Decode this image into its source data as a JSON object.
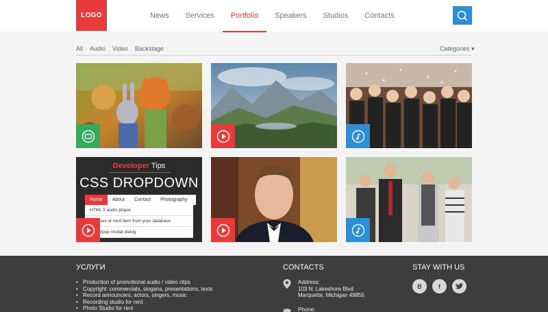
{
  "header": {
    "logo": "LOGO",
    "nav": [
      "News",
      "Services",
      "Portfolio",
      "Speakers",
      "Studios",
      "Contacts"
    ],
    "active_nav": "Portfolio"
  },
  "filters": {
    "items": [
      "All",
      "Audio",
      "Video",
      "Backstage"
    ],
    "categories_label": "Categories ▾"
  },
  "tiles": [
    {
      "image": "animated-characters-cartoon",
      "badge": "video-icon",
      "badge_color": "green"
    },
    {
      "image": "mountain-landscape",
      "badge": "play-icon",
      "badge_color": "red"
    },
    {
      "image": "party-crowd",
      "badge": "music-note-icon",
      "badge_color": "blue"
    },
    {
      "image": "dev-tips-css-dropdown",
      "badge": "play-icon",
      "badge_color": "red"
    },
    {
      "image": "man-portrait-tuxedo",
      "badge": "play-icon",
      "badge_color": "red"
    },
    {
      "image": "band-group-photo",
      "badge": "music-note-icon",
      "badge_color": "blue"
    }
  ],
  "devtips": {
    "brand": "Developer",
    "brand_rest": "Tips",
    "heading": "CSS DROPDOWN",
    "menu": [
      "Home",
      "About",
      "Contact",
      "Photography"
    ],
    "dropdown": [
      "HTML 5 audio player",
      "previous or next item from your database",
      "ery popup modal dialog"
    ]
  },
  "footer": {
    "services_title": "УСЛУГИ",
    "services": [
      "Production of promotional audio / video clips",
      "Copyright: commercials, slogans, presentations, texts",
      "Record announcers, actors, singers, music",
      "Recording studio for rent",
      "Photo Studio for rent"
    ],
    "contacts_title": "CONTACTS",
    "address_label": "Address:",
    "address_line1": "103 N. Lakeshore Blvd",
    "address_line2": "Marquette, Michigan 49855",
    "phone_label": "Phone:",
    "stay_title": "STAY WITH US",
    "social": [
      "B",
      "f",
      "twitter-icon"
    ]
  },
  "colors": {
    "accent_red": "#e63b3b",
    "accent_blue": "#2a8fd4",
    "accent_green": "#33aa5c",
    "footer_bg": "#3d3d3d"
  }
}
